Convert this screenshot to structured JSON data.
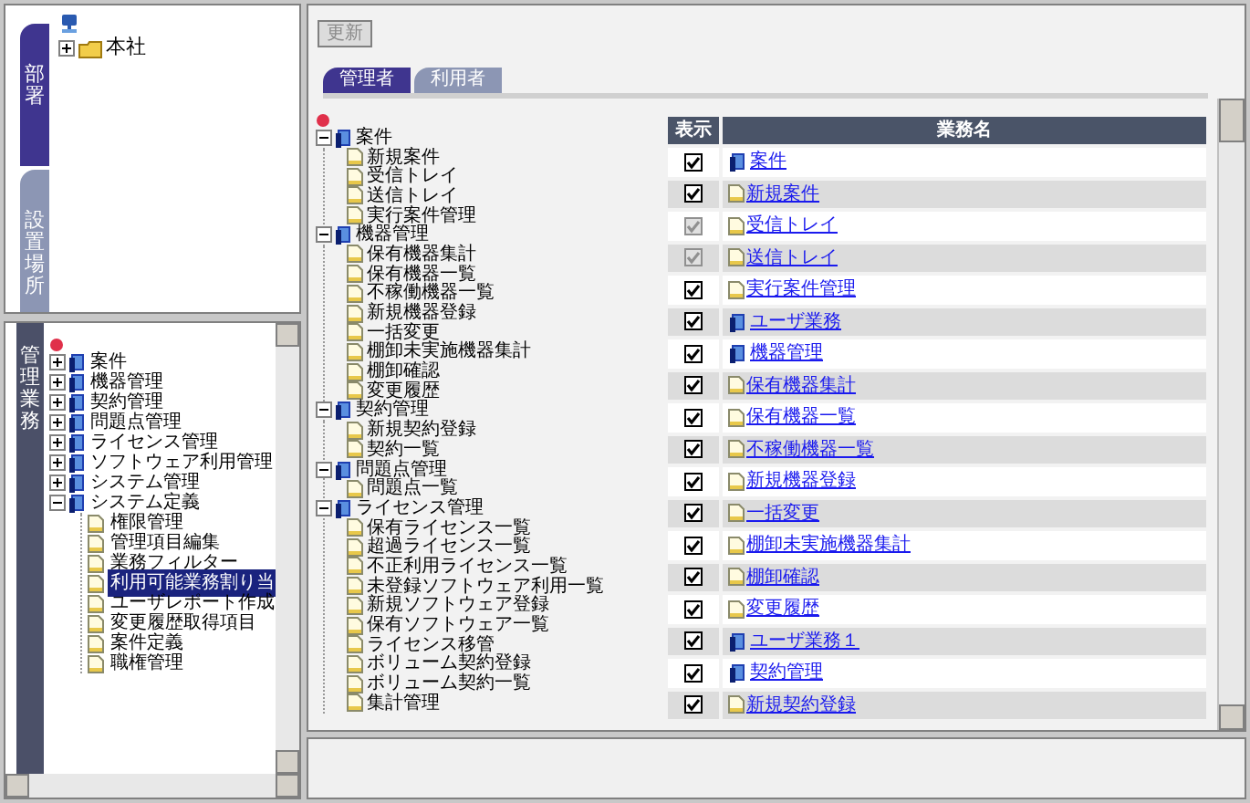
{
  "org_panel": {
    "tabs": [
      {
        "label": "部署",
        "selected": true
      },
      {
        "label": "設置場所",
        "selected": false
      }
    ],
    "tree": [
      {
        "label": "本社",
        "expanded": false
      }
    ]
  },
  "task_panel": {
    "tab": {
      "label": "管理業務"
    },
    "tree": [
      {
        "label": "案件",
        "expanded": false
      },
      {
        "label": "機器管理",
        "expanded": false
      },
      {
        "label": "契約管理",
        "expanded": false
      },
      {
        "label": "問題点管理",
        "expanded": false
      },
      {
        "label": "ライセンス管理",
        "expanded": false
      },
      {
        "label": "ソフトウェア利用管理",
        "expanded": false
      },
      {
        "label": "システム管理",
        "expanded": false
      },
      {
        "label": "システム定義",
        "expanded": true,
        "children": [
          {
            "label": "権限管理",
            "selected": false
          },
          {
            "label": "管理項目編集",
            "selected": false
          },
          {
            "label": "業務フィルター",
            "selected": false
          },
          {
            "label": "利用可能業務割り当",
            "selected": true
          },
          {
            "label": "ユーザレポート作成",
            "selected": false
          },
          {
            "label": "変更履歴取得項目",
            "selected": false
          },
          {
            "label": "案件定義",
            "selected": false
          },
          {
            "label": "職権管理",
            "selected": false
          }
        ]
      }
    ]
  },
  "toolbar": {
    "update_button": {
      "label": "更新",
      "disabled": true
    }
  },
  "tabs": [
    {
      "label": "管理者",
      "selected": true
    },
    {
      "label": "利用者",
      "selected": false
    }
  ],
  "business_tree": [
    {
      "label": "案件",
      "expanded": true,
      "children": [
        "新規案件",
        "受信トレイ",
        "送信トレイ",
        "実行案件管理"
      ]
    },
    {
      "label": "機器管理",
      "expanded": true,
      "children": [
        "保有機器集計",
        "保有機器一覧",
        "不稼働機器一覧",
        "新規機器登録",
        "一括変更",
        "棚卸未実施機器集計",
        "棚卸確認",
        "変更履歴"
      ]
    },
    {
      "label": "契約管理",
      "expanded": true,
      "children": [
        "新規契約登録",
        "契約一覧"
      ]
    },
    {
      "label": "問題点管理",
      "expanded": true,
      "children": [
        "問題点一覧"
      ]
    },
    {
      "label": "ライセンス管理",
      "expanded": true,
      "children": [
        "保有ライセンス一覧",
        "超過ライセンス一覧",
        "不正利用ライセンス一覧",
        "未登録ソフトウェア利用一覧",
        "新規ソフトウェア登録",
        "保有ソフトウェア一覧",
        "ライセンス移管",
        "ボリューム契約登録",
        "ボリューム契約一覧",
        "集計管理"
      ]
    }
  ],
  "table": {
    "columns": [
      "表示",
      "業務名"
    ],
    "rows": [
      {
        "kind": "group",
        "name": "案件",
        "checked": true,
        "disabled": false
      },
      {
        "kind": "page",
        "name": "新規案件",
        "checked": true,
        "disabled": false
      },
      {
        "kind": "page",
        "name": "受信トレイ",
        "checked": true,
        "disabled": true
      },
      {
        "kind": "page",
        "name": "送信トレイ",
        "checked": true,
        "disabled": true
      },
      {
        "kind": "page",
        "name": "実行案件管理",
        "checked": true,
        "disabled": false
      },
      {
        "kind": "group",
        "name": "ユーザ業務",
        "checked": true,
        "disabled": false
      },
      {
        "kind": "group",
        "name": "機器管理",
        "checked": true,
        "disabled": false
      },
      {
        "kind": "page",
        "name": "保有機器集計",
        "checked": true,
        "disabled": false
      },
      {
        "kind": "page",
        "name": "保有機器一覧",
        "checked": true,
        "disabled": false
      },
      {
        "kind": "page",
        "name": "不稼働機器一覧",
        "checked": true,
        "disabled": false
      },
      {
        "kind": "page",
        "name": "新規機器登録",
        "checked": true,
        "disabled": false
      },
      {
        "kind": "page",
        "name": "一括変更",
        "checked": true,
        "disabled": false
      },
      {
        "kind": "page",
        "name": "棚卸未実施機器集計",
        "checked": true,
        "disabled": false
      },
      {
        "kind": "page",
        "name": "棚卸確認",
        "checked": true,
        "disabled": false
      },
      {
        "kind": "page",
        "name": "変更履歴",
        "checked": true,
        "disabled": false
      },
      {
        "kind": "group",
        "name": "ユーザ業務１",
        "checked": true,
        "disabled": false
      },
      {
        "kind": "group",
        "name": "契約管理",
        "checked": true,
        "disabled": false
      },
      {
        "kind": "page",
        "name": "新規契約登録",
        "checked": true,
        "disabled": false
      }
    ]
  }
}
